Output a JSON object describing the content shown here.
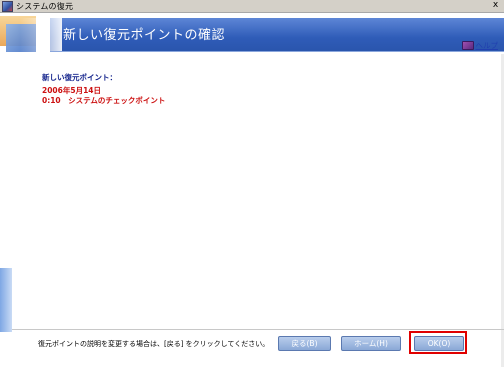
{
  "window": {
    "title": "システムの復元",
    "close_glyph": "x"
  },
  "header": {
    "title": "新しい復元ポイントの確認"
  },
  "help": {
    "label": "ヘルプ"
  },
  "main": {
    "label": "新しい復元ポイント：",
    "date": "2006年5月14日",
    "description": "0:10　システムのチェックポイント"
  },
  "footer": {
    "instruction": "復元ポイントの説明を変更する場合は、[戻る] をクリックしてください。",
    "buttons": {
      "back": "戻る(B)",
      "home": "ホーム(H)",
      "ok": "OK(O)"
    }
  },
  "colors": {
    "header_band": "#2f5cb8",
    "label_text": "#10208a",
    "value_text": "#cc1010",
    "highlight": "#e00000",
    "button": "#8aa8d6"
  },
  "icons": {
    "app": "system-restore-icon",
    "help": "help-book-icon"
  }
}
